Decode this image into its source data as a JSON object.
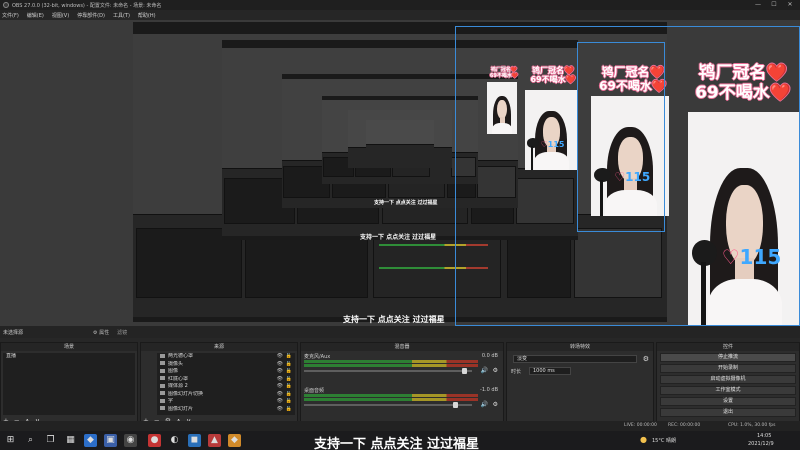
{
  "window": {
    "title": "OBS 27.0.0 (32-bit, windows) - 配置文件: 未命名 - 场景: 未命名",
    "controls": [
      "—",
      "☐",
      "✕"
    ]
  },
  "menu": [
    "文件(F)",
    "编辑(E)",
    "视图(V)",
    "停靠部件(D)",
    "工具(T)",
    "帮助(H)"
  ],
  "preview": {
    "overlay_text": "鸨厂冠名❤️ 69不喝水❤️",
    "overlay_line1": "鸨厂冠名❤️",
    "overlay_line2": "69不喝水❤️",
    "badge_count": "115",
    "caption": "支持一下 点点关注 过过福星"
  },
  "scene_header": {
    "label": "未选择源",
    "properties_button": "⚙ 属性",
    "filters_button": "滤镜"
  },
  "scenes": {
    "title": "场景",
    "items": [
      "直播"
    ],
    "tools": [
      "+",
      "−",
      "∧",
      "∨"
    ]
  },
  "sources": {
    "title": "来源",
    "items": [
      "两光德心罩",
      "摄像头",
      "图像",
      "红底心罩",
      "媒体源 2",
      "图像幻灯片切换",
      "字",
      "图像幻灯片"
    ],
    "tools": [
      "+",
      "−",
      "⚙",
      "∧",
      "∨"
    ]
  },
  "mixer": {
    "title": "混音器",
    "channels": [
      {
        "name": "麦克风/Aux",
        "db": "0.0 dB",
        "level": 0.96
      },
      {
        "name": "桌面音频",
        "db": "-1.0 dB",
        "level": 0.9
      }
    ]
  },
  "transitions": {
    "title": "转场特效",
    "type": "淡变",
    "duration_label": "时长",
    "duration": "1000 ms"
  },
  "controls": {
    "title": "控件",
    "buttons": [
      "停止推流",
      "开始录制",
      "启动虚拟摄像机",
      "工作室模式",
      "设置",
      "退出"
    ]
  },
  "status": {
    "dropped": "LIVE: 00:00:00",
    "rec": "REC: 00:00:00",
    "cpu": "CPU: 1.0%, 30.00 fps",
    "extra": "kb/s"
  },
  "taskbar": {
    "caption": "支持一下 点点关注 过过福星",
    "weather": "15°C 晴朗",
    "time": "14:05",
    "date": "2021/12/9"
  }
}
